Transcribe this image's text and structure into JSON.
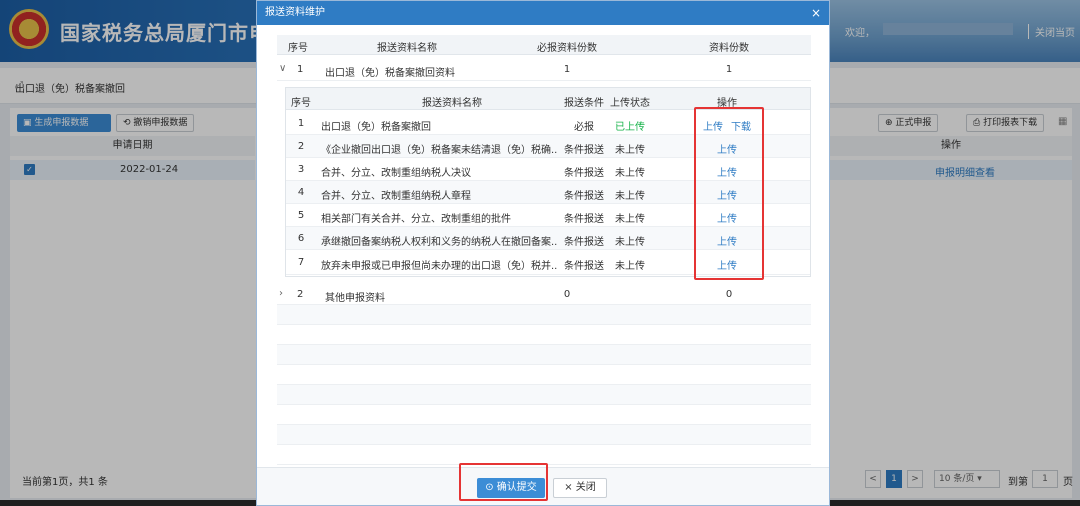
{
  "header": {
    "title": "国家税务总局厦门市电",
    "welcome": "欢迎，",
    "logout": "关闭当页"
  },
  "page": {
    "breadcrumb": "出口退（免）税备案撤回",
    "toolbar": {
      "generate": "生成申报数据",
      "revoke": "撤销申报数据",
      "submit": "正式申报",
      "print": "打印报表下载"
    },
    "table": {
      "col_date": "申请日期",
      "col_action": "操作",
      "row_date": "2022-01-24",
      "row_action": "申报明细查看"
    },
    "footer": {
      "summary": "当前第1页，共1 条",
      "prev": "<",
      "page": "1",
      "next": ">",
      "per_page": "10 条/页",
      "goto_label": "到第",
      "goto_value": "1",
      "page_unit": "页"
    }
  },
  "modal": {
    "title": "报送资料维护",
    "close": "×",
    "headers": {
      "no": "序号",
      "name": "报送资料名称",
      "required": "必报资料份数",
      "count": "资料份数"
    },
    "groups": [
      {
        "no": "1",
        "name": "出口退（免）税备案撤回资料",
        "required": "1",
        "count": "1",
        "expanded": true
      },
      {
        "no": "2",
        "name": "其他申报资料",
        "required": "0",
        "count": "0",
        "expanded": false
      }
    ],
    "inner_headers": {
      "no": "序号",
      "name": "报送资料名称",
      "cond": "报送条件",
      "status": "上传状态",
      "op": "操作"
    },
    "items": [
      {
        "no": "1",
        "name": "出口退（免）税备案撤回",
        "cond": "必报",
        "status": "已上传",
        "upload": "上传",
        "download": "下载"
      },
      {
        "no": "2",
        "name": "《企业撤回出口退（免）税备案未结清退（免）税确...",
        "cond": "条件报送",
        "status": "未上传",
        "upload": "上传"
      },
      {
        "no": "3",
        "name": "合并、分立、改制重组纳税人决议",
        "cond": "条件报送",
        "status": "未上传",
        "upload": "上传"
      },
      {
        "no": "4",
        "name": "合并、分立、改制重组纳税人章程",
        "cond": "条件报送",
        "status": "未上传",
        "upload": "上传"
      },
      {
        "no": "5",
        "name": "相关部门有关合并、分立、改制重组的批件",
        "cond": "条件报送",
        "status": "未上传",
        "upload": "上传"
      },
      {
        "no": "6",
        "name": "承继撤回备案纳税人权利和义务的纳税人在撤回备案...",
        "cond": "条件报送",
        "status": "未上传",
        "upload": "上传"
      },
      {
        "no": "7",
        "name": "放弃未申报或已申报但尚未办理的出口退（免）税并...",
        "cond": "条件报送",
        "status": "未上传",
        "upload": "上传"
      }
    ],
    "confirm": "确认提交",
    "cancel": "关闭"
  }
}
